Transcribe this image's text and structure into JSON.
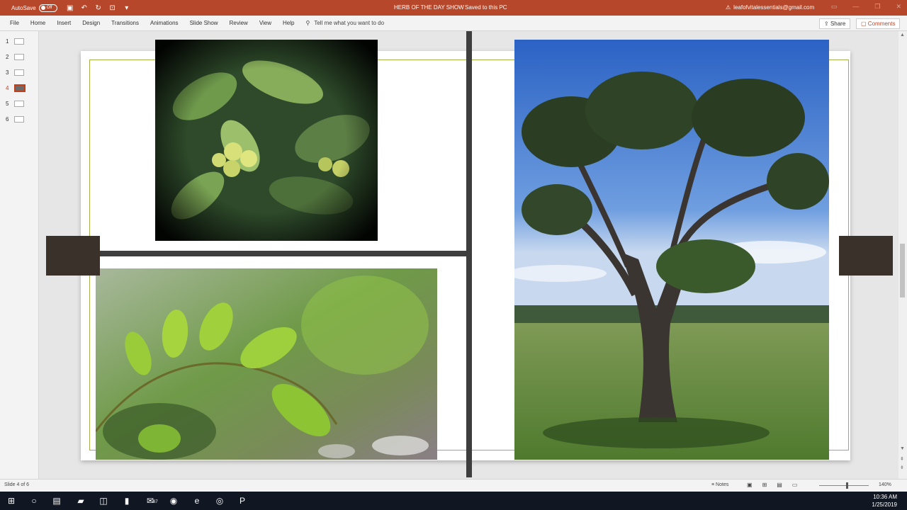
{
  "titlebar": {
    "autosave_label": "AutoSave",
    "autosave_state": "Off",
    "doc_title": "HERB OF THE DAY SHOW",
    "save_status": "Saved to this PC",
    "user_email": "leafofvitalessentials@gmail.com",
    "warning_icon": "warning-icon"
  },
  "ribbon": {
    "tabs": [
      "File",
      "Home",
      "Insert",
      "Design",
      "Transitions",
      "Animations",
      "Slide Show",
      "Review",
      "View",
      "Help"
    ],
    "tell_me": "Tell me what you want to do",
    "share": "Share",
    "comments": "Comments"
  },
  "thumbnails": [
    {
      "num": "1"
    },
    {
      "num": "2"
    },
    {
      "num": "3"
    },
    {
      "num": "4"
    },
    {
      "num": "5"
    },
    {
      "num": "6"
    }
  ],
  "status": {
    "slide_info": "Slide 4 of 6",
    "notes": "Notes",
    "zoom": "140%"
  },
  "taskbar": {
    "time": "10:36 AM",
    "date": "1/25/2019",
    "mail_badge": "87"
  },
  "colors": {
    "accent": "#b7472a",
    "frame": "#a3b14a",
    "dark_bar": "#3e3e3e"
  }
}
